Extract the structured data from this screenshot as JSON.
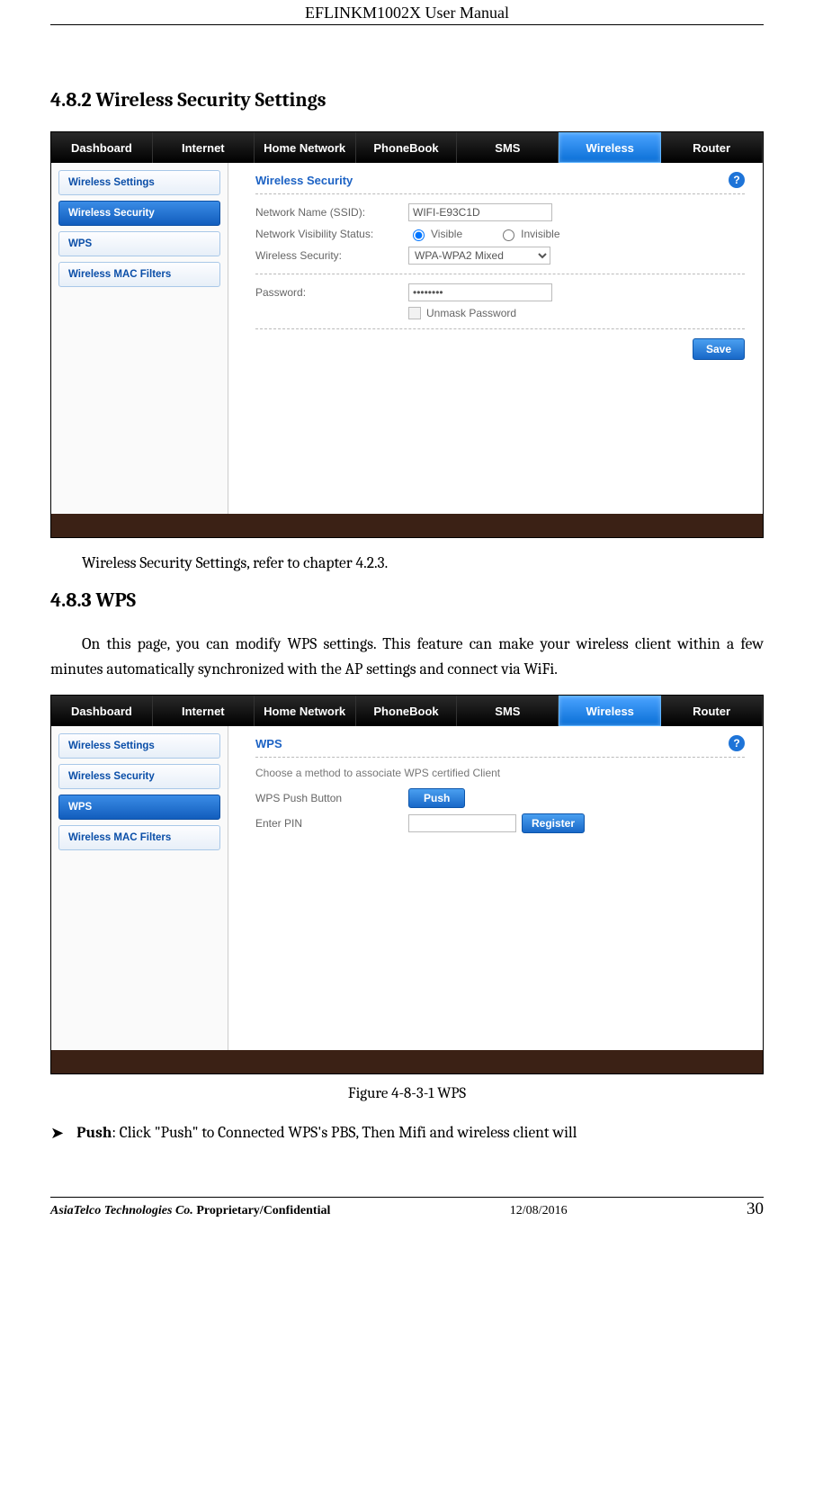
{
  "header": {
    "product": "EFLINKM1002X",
    "doc": "User Manual"
  },
  "sections": {
    "sec1_title": "4.8.2 Wireless Security Settings",
    "sec1_caption": "Wireless Security Settings, refer to chapter 4.2.3.",
    "sec2_title": "4.8.3 WPS",
    "sec2_para": "On this page, you can modify WPS settings. This feature can make your wireless client within a few minutes automatically synchronized with the AP settings and connect via WiFi.",
    "figure_caption": "Figure 4-8-3-1 WPS",
    "bullet_arrow": "➤",
    "bullet_label": "Push",
    "bullet_text": ": Click \"Push\" to Connected WPS's PBS, Then Mifi and wireless client will"
  },
  "footer": {
    "company": "AsiaTelco Technologies Co.",
    "classification": "Proprietary/Confidential",
    "date": "12/08/2016",
    "page": "30"
  },
  "router_ui": {
    "nav": {
      "dashboard": "Dashboard",
      "internet": "Internet",
      "home_network": "Home Network",
      "phonebook": "PhoneBook",
      "sms": "SMS",
      "wireless": "Wireless",
      "router": "Router"
    },
    "sidebar": {
      "wireless_settings": "Wireless Settings",
      "wireless_security": "Wireless Security",
      "wps": "WPS",
      "wireless_mac_filters": "Wireless MAC Filters"
    },
    "security_panel": {
      "title": "Wireless Security",
      "ssid_label": "Network Name (SSID):",
      "ssid_value": "WIFI-E93C1D",
      "visibility_label": "Network Visibility Status:",
      "visible_opt": "Visible",
      "invisible_opt": "Invisible",
      "security_label": "Wireless Security:",
      "security_value": "WPA-WPA2 Mixed",
      "password_label": "Password:",
      "password_value": "••••••••",
      "unmask_label": "Unmask Password",
      "save_btn": "Save"
    },
    "wps_panel": {
      "title": "WPS",
      "subtitle": "Choose a method to associate WPS certified Client",
      "push_label": "WPS Push Button",
      "push_btn": "Push",
      "pin_label": "Enter PIN",
      "pin_value": "",
      "register_btn": "Register"
    },
    "help_glyph": "?"
  }
}
